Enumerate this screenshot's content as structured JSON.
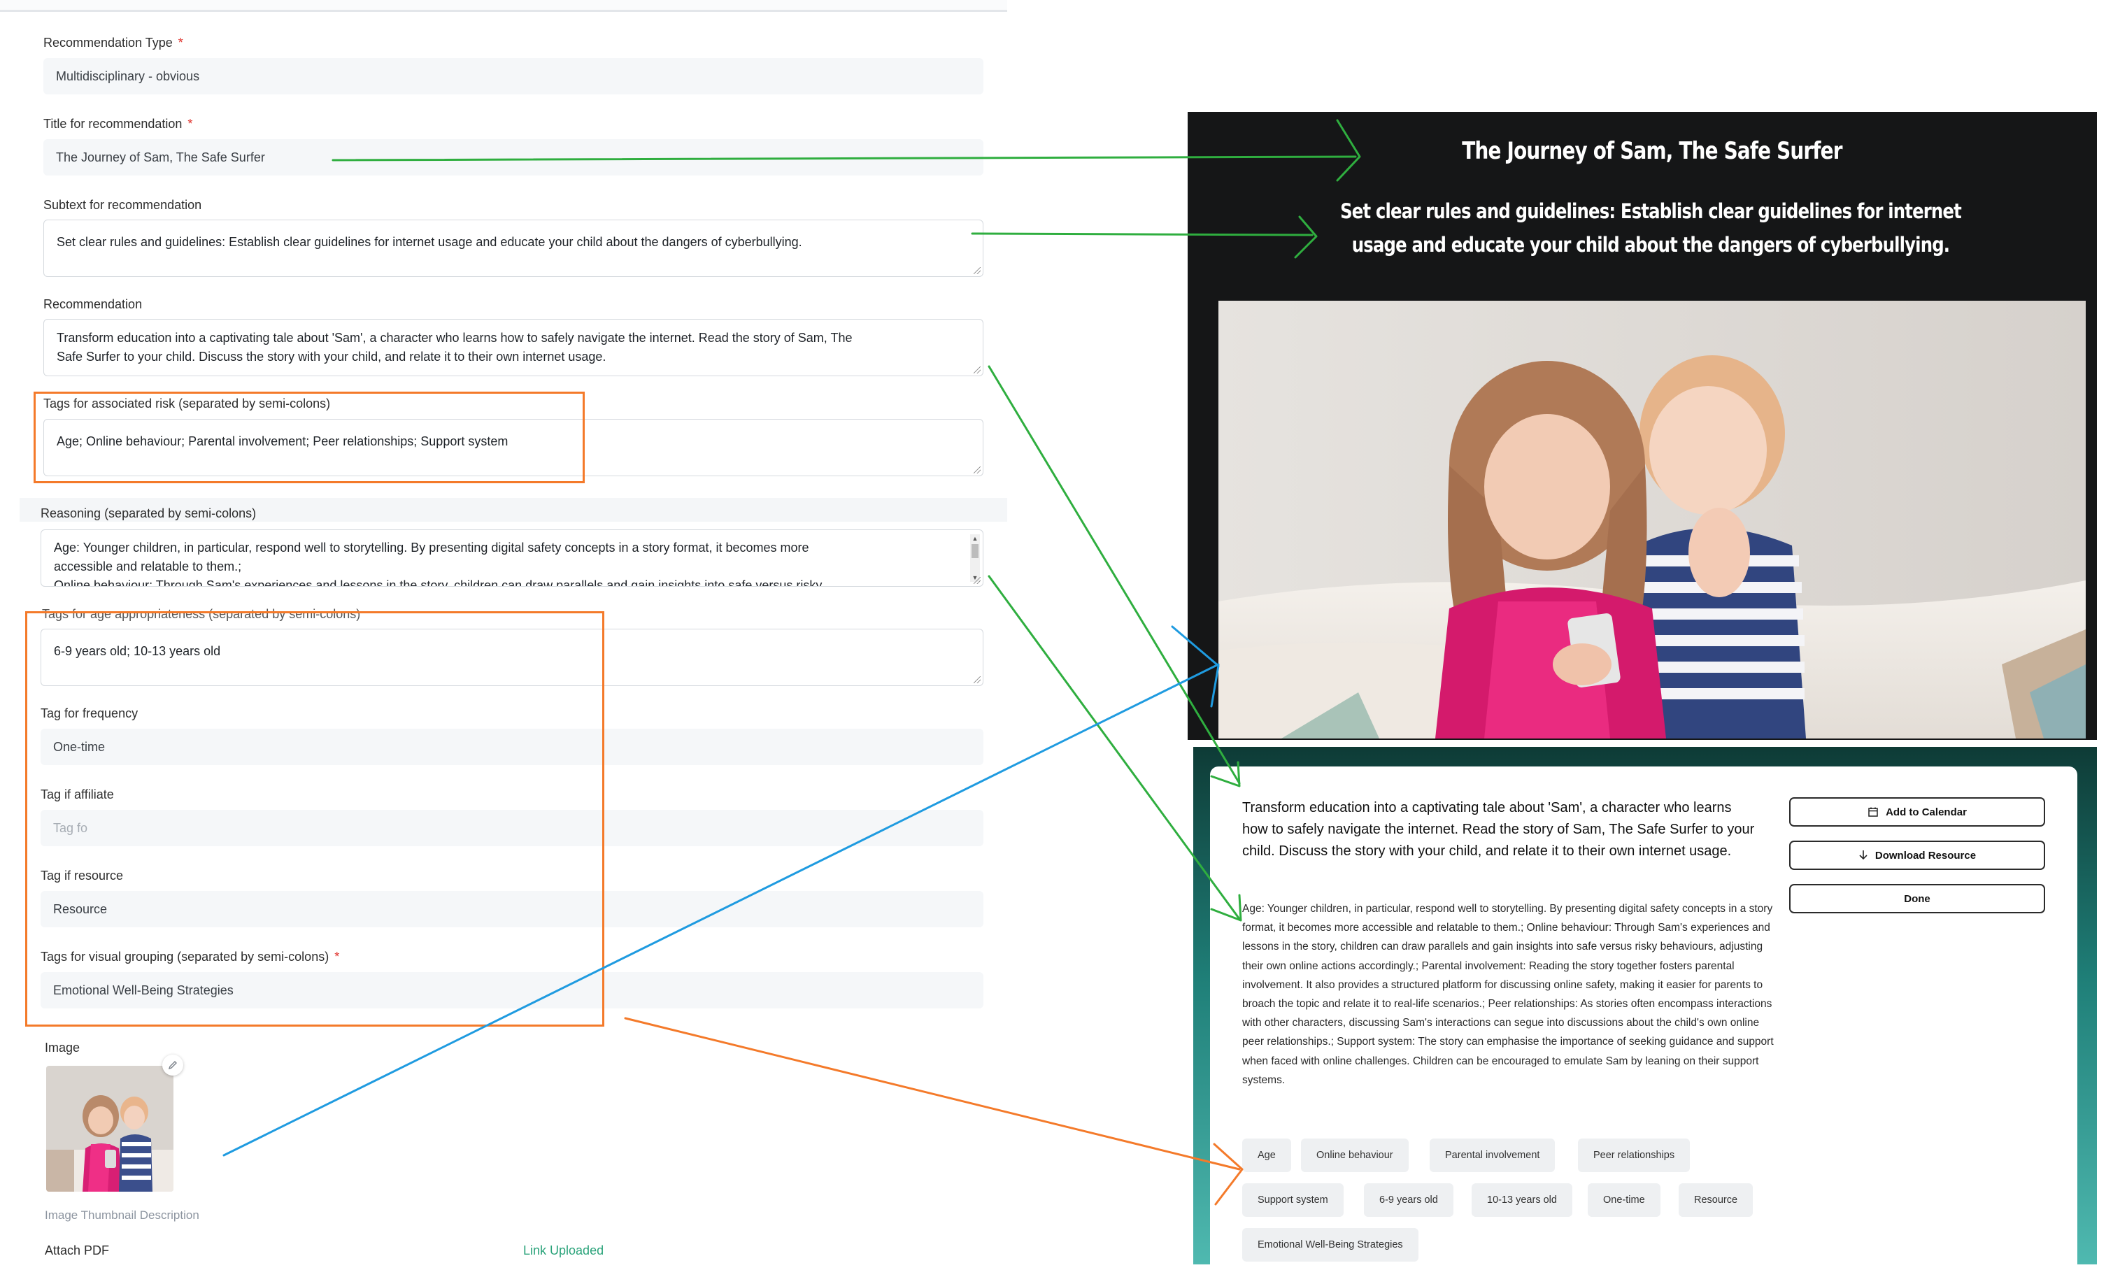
{
  "form": {
    "recommendation_type": {
      "label": "Recommendation Type",
      "required_mark": "*",
      "value": "Multidisciplinary - obvious"
    },
    "title": {
      "label": "Title for recommendation",
      "required_mark": "*",
      "value": "The Journey of Sam, The Safe Surfer"
    },
    "subtext": {
      "label": "Subtext for recommendation",
      "value": "Set clear rules and guidelines: Establish clear guidelines for internet usage and educate your child about the dangers of cyberbullying."
    },
    "recommendation": {
      "label": "Recommendation",
      "value_line1": "Transform education into a captivating tale about 'Sam', a character who learns how to safely navigate the internet. Read the story of Sam, The",
      "value_line2": "Safe Surfer to your child. Discuss the story with your child, and relate it to their own internet usage."
    },
    "risk_tags": {
      "label": "Tags for associated risk (separated by semi-colons)",
      "value": "Age; Online behaviour; Parental involvement; Peer relationships; Support system"
    },
    "reasoning": {
      "label": "Reasoning (separated by semi-colons)",
      "value_line1": "Age: Younger children, in particular, respond well to storytelling. By presenting digital safety concepts in a story format, it becomes more",
      "value_line2": "accessible and relatable to them.;",
      "value_line3": "Online behaviour: Through Sam's experiences and lessons in the story, children can draw parallels and gain insights into safe versus risky"
    },
    "age_tags": {
      "label": "Tags for age appropriateness (separated by semi-colons)",
      "value": "6-9 years old; 10-13 years old"
    },
    "frequency": {
      "label": "Tag for frequency",
      "value": "One-time"
    },
    "affiliate": {
      "label": "Tag if affiliate",
      "placeholder": "Tag fo"
    },
    "resource": {
      "label": "Tag if resource",
      "value": "Resource"
    },
    "visual_grouping": {
      "label": "Tags for visual grouping (separated by semi-colons)",
      "required_mark": "*",
      "value": "Emotional Well-Being Strategies"
    },
    "image": {
      "label": "Image",
      "thumbnail_description": "Image Thumbnail Description"
    },
    "attach_pdf": {
      "label": "Attach PDF",
      "status": "Link Uploaded"
    }
  },
  "preview": {
    "title": "The Journey of Sam, The Safe Surfer",
    "subtitle": "Set clear rules and guidelines: Establish clear guidelines for internet usage and educate your child about the dangers of cyberbullying.",
    "lead": "Transform education into a captivating tale about 'Sam', a character who learns how to safely navigate the internet. Read the story of Sam, The Safe Surfer to your child. Discuss the story with your child, and relate it to their own internet usage.",
    "reasoning": "Age: Younger children, in particular, respond well to storytelling. By presenting digital safety concepts in a story format, it becomes more accessible and relatable to them.; Online behaviour: Through Sam's experiences and lessons in the story, children can draw parallels and gain insights into safe versus risky behaviours, adjusting their own online actions accordingly.; Parental involvement: Reading the story together fosters parental involvement. It also provides a structured platform for discussing online safety, making it easier for parents to broach the topic and relate it to real-life scenarios.; Peer relationships: As stories often encompass interactions with other characters, discussing Sam's interactions can segue into discussions about the child's own online peer relationships.; Support system: The story can emphasise the importance of seeking guidance and support when faced with online challenges. Children can be encouraged to emulate Sam by leaning on their support systems.",
    "buttons": {
      "calendar": "Add to Calendar",
      "download": "Download Resource",
      "done": "Done"
    },
    "chips": [
      "Age",
      "Online behaviour",
      "Parental involvement",
      "Peer relationships",
      "Support system",
      "6-9 years old",
      "10-13 years old",
      "One-time",
      "Resource",
      "Emotional Well-Being Strategies"
    ]
  },
  "colors": {
    "arrow_green": "#2fae3f",
    "arrow_blue": "#1f9be0",
    "arrow_orange": "#f47a2a",
    "highlight_orange": "#f47a2a"
  }
}
